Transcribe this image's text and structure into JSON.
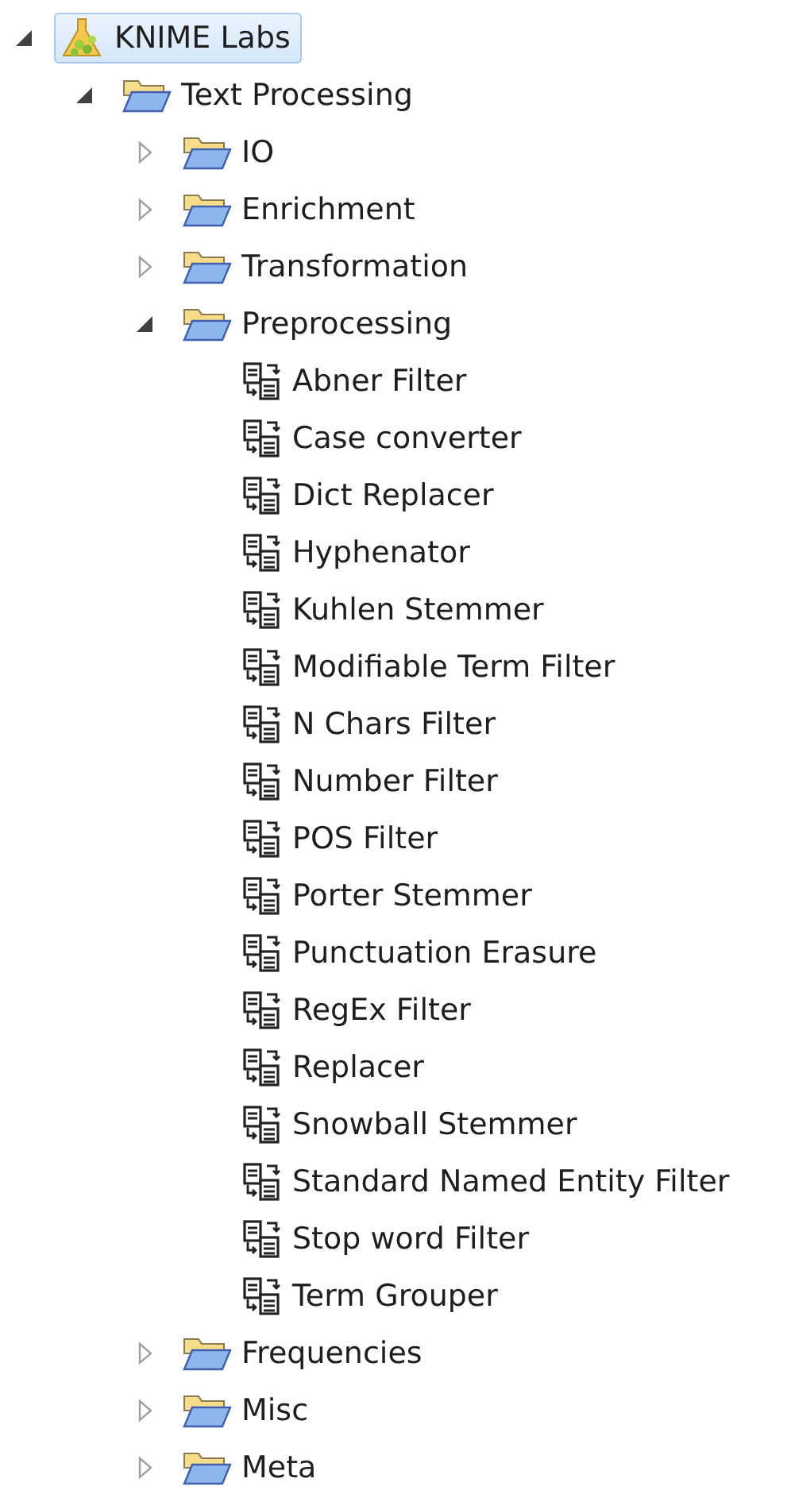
{
  "tree": [
    {
      "label": "KNIME Labs",
      "kind": "category",
      "selected": true,
      "expanded": true,
      "children": [
        {
          "label": "Text Processing",
          "kind": "folder",
          "selected": false,
          "expanded": true,
          "children": [
            {
              "label": "IO",
              "kind": "folder",
              "selected": false,
              "expanded": false
            },
            {
              "label": "Enrichment",
              "kind": "folder",
              "selected": false,
              "expanded": false
            },
            {
              "label": "Transformation",
              "kind": "folder",
              "selected": false,
              "expanded": false
            },
            {
              "label": "Preprocessing",
              "kind": "folder",
              "selected": false,
              "expanded": true,
              "children": [
                {
                  "label": "Abner Filter",
                  "kind": "node",
                  "selected": false
                },
                {
                  "label": "Case converter",
                  "kind": "node",
                  "selected": false
                },
                {
                  "label": "Dict Replacer",
                  "kind": "node",
                  "selected": false
                },
                {
                  "label": "Hyphenator",
                  "kind": "node",
                  "selected": false
                },
                {
                  "label": "Kuhlen Stemmer",
                  "kind": "node",
                  "selected": false
                },
                {
                  "label": "Modifiable Term Filter",
                  "kind": "node",
                  "selected": false
                },
                {
                  "label": "N Chars Filter",
                  "kind": "node",
                  "selected": false
                },
                {
                  "label": "Number Filter",
                  "kind": "node",
                  "selected": false
                },
                {
                  "label": "POS Filter",
                  "kind": "node",
                  "selected": false
                },
                {
                  "label": "Porter Stemmer",
                  "kind": "node",
                  "selected": false
                },
                {
                  "label": "Punctuation Erasure",
                  "kind": "node",
                  "selected": false
                },
                {
                  "label": "RegEx Filter",
                  "kind": "node",
                  "selected": false
                },
                {
                  "label": "Replacer",
                  "kind": "node",
                  "selected": false
                },
                {
                  "label": "Snowball Stemmer",
                  "kind": "node",
                  "selected": false
                },
                {
                  "label": "Standard Named Entity Filter",
                  "kind": "node",
                  "selected": false
                },
                {
                  "label": "Stop word Filter",
                  "kind": "node",
                  "selected": false
                },
                {
                  "label": "Term Grouper",
                  "kind": "node",
                  "selected": false
                }
              ]
            },
            {
              "label": "Frequencies",
              "kind": "folder",
              "selected": false,
              "expanded": false
            },
            {
              "label": "Misc",
              "kind": "folder",
              "selected": false,
              "expanded": false
            },
            {
              "label": "Meta",
              "kind": "folder",
              "selected": false,
              "expanded": false
            }
          ]
        }
      ]
    }
  ]
}
